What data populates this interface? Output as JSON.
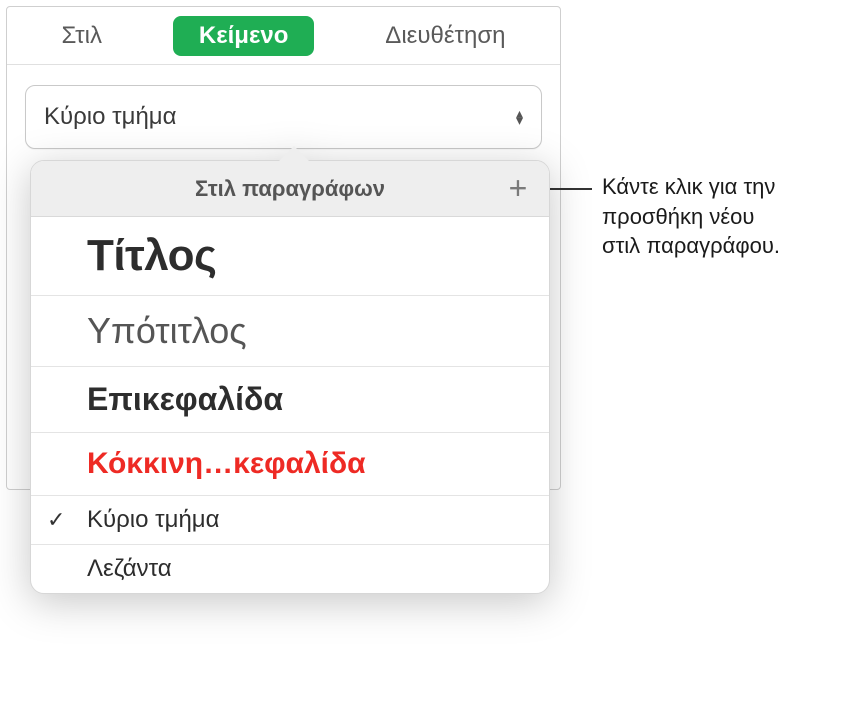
{
  "tabs": {
    "style": "Στιλ",
    "text": "Κείμενο",
    "arrange": "Διευθέτηση"
  },
  "selector": {
    "current": "Κύριο τμήμα"
  },
  "popover": {
    "title": "Στιλ παραγράφων",
    "items": {
      "title": "Τίτλος",
      "subtitle": "Υπότιτλος",
      "heading": "Επικεφαλίδα",
      "red_heading": "Κόκκινη…κεφαλίδα",
      "body": "Κύριο τμήμα",
      "caption": "Λεζάντα"
    },
    "checkmark": "✓",
    "plus": "+"
  },
  "callout": {
    "line1": "Κάντε κλικ για την",
    "line2": "προσθήκη νέου",
    "line3": "στιλ παραγράφου."
  }
}
